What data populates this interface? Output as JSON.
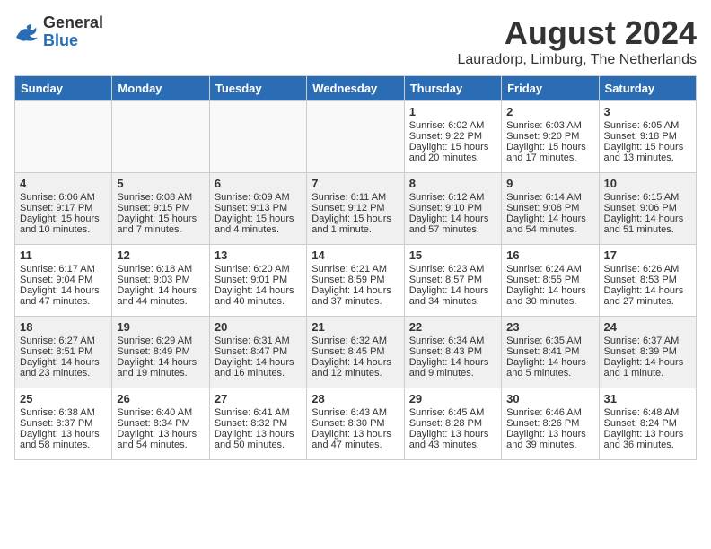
{
  "header": {
    "logo_general": "General",
    "logo_blue": "Blue",
    "title": "August 2024",
    "subtitle": "Lauradorp, Limburg, The Netherlands"
  },
  "days_of_week": [
    "Sunday",
    "Monday",
    "Tuesday",
    "Wednesday",
    "Thursday",
    "Friday",
    "Saturday"
  ],
  "weeks": [
    [
      {
        "day": "",
        "info": ""
      },
      {
        "day": "",
        "info": ""
      },
      {
        "day": "",
        "info": ""
      },
      {
        "day": "",
        "info": ""
      },
      {
        "day": "1",
        "info": "Sunrise: 6:02 AM\nSunset: 9:22 PM\nDaylight: 15 hours\nand 20 minutes."
      },
      {
        "day": "2",
        "info": "Sunrise: 6:03 AM\nSunset: 9:20 PM\nDaylight: 15 hours\nand 17 minutes."
      },
      {
        "day": "3",
        "info": "Sunrise: 6:05 AM\nSunset: 9:18 PM\nDaylight: 15 hours\nand 13 minutes."
      }
    ],
    [
      {
        "day": "4",
        "info": "Sunrise: 6:06 AM\nSunset: 9:17 PM\nDaylight: 15 hours\nand 10 minutes."
      },
      {
        "day": "5",
        "info": "Sunrise: 6:08 AM\nSunset: 9:15 PM\nDaylight: 15 hours\nand 7 minutes."
      },
      {
        "day": "6",
        "info": "Sunrise: 6:09 AM\nSunset: 9:13 PM\nDaylight: 15 hours\nand 4 minutes."
      },
      {
        "day": "7",
        "info": "Sunrise: 6:11 AM\nSunset: 9:12 PM\nDaylight: 15 hours\nand 1 minute."
      },
      {
        "day": "8",
        "info": "Sunrise: 6:12 AM\nSunset: 9:10 PM\nDaylight: 14 hours\nand 57 minutes."
      },
      {
        "day": "9",
        "info": "Sunrise: 6:14 AM\nSunset: 9:08 PM\nDaylight: 14 hours\nand 54 minutes."
      },
      {
        "day": "10",
        "info": "Sunrise: 6:15 AM\nSunset: 9:06 PM\nDaylight: 14 hours\nand 51 minutes."
      }
    ],
    [
      {
        "day": "11",
        "info": "Sunrise: 6:17 AM\nSunset: 9:04 PM\nDaylight: 14 hours\nand 47 minutes."
      },
      {
        "day": "12",
        "info": "Sunrise: 6:18 AM\nSunset: 9:03 PM\nDaylight: 14 hours\nand 44 minutes."
      },
      {
        "day": "13",
        "info": "Sunrise: 6:20 AM\nSunset: 9:01 PM\nDaylight: 14 hours\nand 40 minutes."
      },
      {
        "day": "14",
        "info": "Sunrise: 6:21 AM\nSunset: 8:59 PM\nDaylight: 14 hours\nand 37 minutes."
      },
      {
        "day": "15",
        "info": "Sunrise: 6:23 AM\nSunset: 8:57 PM\nDaylight: 14 hours\nand 34 minutes."
      },
      {
        "day": "16",
        "info": "Sunrise: 6:24 AM\nSunset: 8:55 PM\nDaylight: 14 hours\nand 30 minutes."
      },
      {
        "day": "17",
        "info": "Sunrise: 6:26 AM\nSunset: 8:53 PM\nDaylight: 14 hours\nand 27 minutes."
      }
    ],
    [
      {
        "day": "18",
        "info": "Sunrise: 6:27 AM\nSunset: 8:51 PM\nDaylight: 14 hours\nand 23 minutes."
      },
      {
        "day": "19",
        "info": "Sunrise: 6:29 AM\nSunset: 8:49 PM\nDaylight: 14 hours\nand 19 minutes."
      },
      {
        "day": "20",
        "info": "Sunrise: 6:31 AM\nSunset: 8:47 PM\nDaylight: 14 hours\nand 16 minutes."
      },
      {
        "day": "21",
        "info": "Sunrise: 6:32 AM\nSunset: 8:45 PM\nDaylight: 14 hours\nand 12 minutes."
      },
      {
        "day": "22",
        "info": "Sunrise: 6:34 AM\nSunset: 8:43 PM\nDaylight: 14 hours\nand 9 minutes."
      },
      {
        "day": "23",
        "info": "Sunrise: 6:35 AM\nSunset: 8:41 PM\nDaylight: 14 hours\nand 5 minutes."
      },
      {
        "day": "24",
        "info": "Sunrise: 6:37 AM\nSunset: 8:39 PM\nDaylight: 14 hours\nand 1 minute."
      }
    ],
    [
      {
        "day": "25",
        "info": "Sunrise: 6:38 AM\nSunset: 8:37 PM\nDaylight: 13 hours\nand 58 minutes."
      },
      {
        "day": "26",
        "info": "Sunrise: 6:40 AM\nSunset: 8:34 PM\nDaylight: 13 hours\nand 54 minutes."
      },
      {
        "day": "27",
        "info": "Sunrise: 6:41 AM\nSunset: 8:32 PM\nDaylight: 13 hours\nand 50 minutes."
      },
      {
        "day": "28",
        "info": "Sunrise: 6:43 AM\nSunset: 8:30 PM\nDaylight: 13 hours\nand 47 minutes."
      },
      {
        "day": "29",
        "info": "Sunrise: 6:45 AM\nSunset: 8:28 PM\nDaylight: 13 hours\nand 43 minutes."
      },
      {
        "day": "30",
        "info": "Sunrise: 6:46 AM\nSunset: 8:26 PM\nDaylight: 13 hours\nand 39 minutes."
      },
      {
        "day": "31",
        "info": "Sunrise: 6:48 AM\nSunset: 8:24 PM\nDaylight: 13 hours\nand 36 minutes."
      }
    ]
  ]
}
